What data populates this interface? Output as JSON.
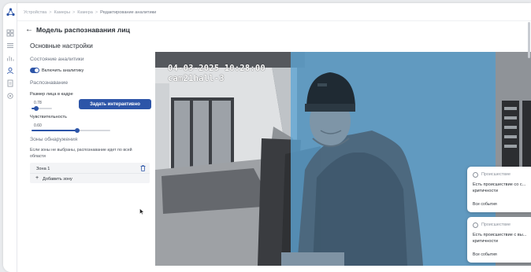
{
  "breadcrumb": {
    "items": [
      "Устройства",
      "Камеры",
      "Камера",
      "Редактирование аналитики"
    ]
  },
  "header": {
    "back_icon": "arrow-left-icon",
    "title": "Модель распознавания лиц"
  },
  "settings": {
    "section_title": "Основные настройки",
    "analytics_state_label": "Состояние аналитики",
    "toggle_label": "Включить аналитику",
    "toggle_on": true,
    "recognition_label": "Распознавание",
    "face_size": {
      "label": "Размер лица в кадре",
      "value": "0.78",
      "fraction": 0.22
    },
    "interactive_button": "Задать интерактивно",
    "sensitivity": {
      "label": "Чувствительность",
      "value": "0.60",
      "fraction": 0.58
    },
    "zones_label": "Зоны обнаружения",
    "zones_hint": "Если зоны не выбраны, распознавание идет по всей области",
    "zone_item": "Зона 1",
    "add_zone_label": "Добавить зону"
  },
  "video": {
    "timestamp": "04-03-2025 10:28:00",
    "camera_name": "cam21hall-3",
    "zone_overlay_color": "#5fa7d6"
  },
  "events": [
    {
      "type": "Происшествие",
      "text": "Есть происшествие со с... критичности",
      "link": "Все события"
    },
    {
      "type": "Происшествие",
      "text": "Есть происшествие с вы... критичности",
      "link": "Все события"
    }
  ],
  "colors": {
    "accent": "#2d55a8"
  }
}
